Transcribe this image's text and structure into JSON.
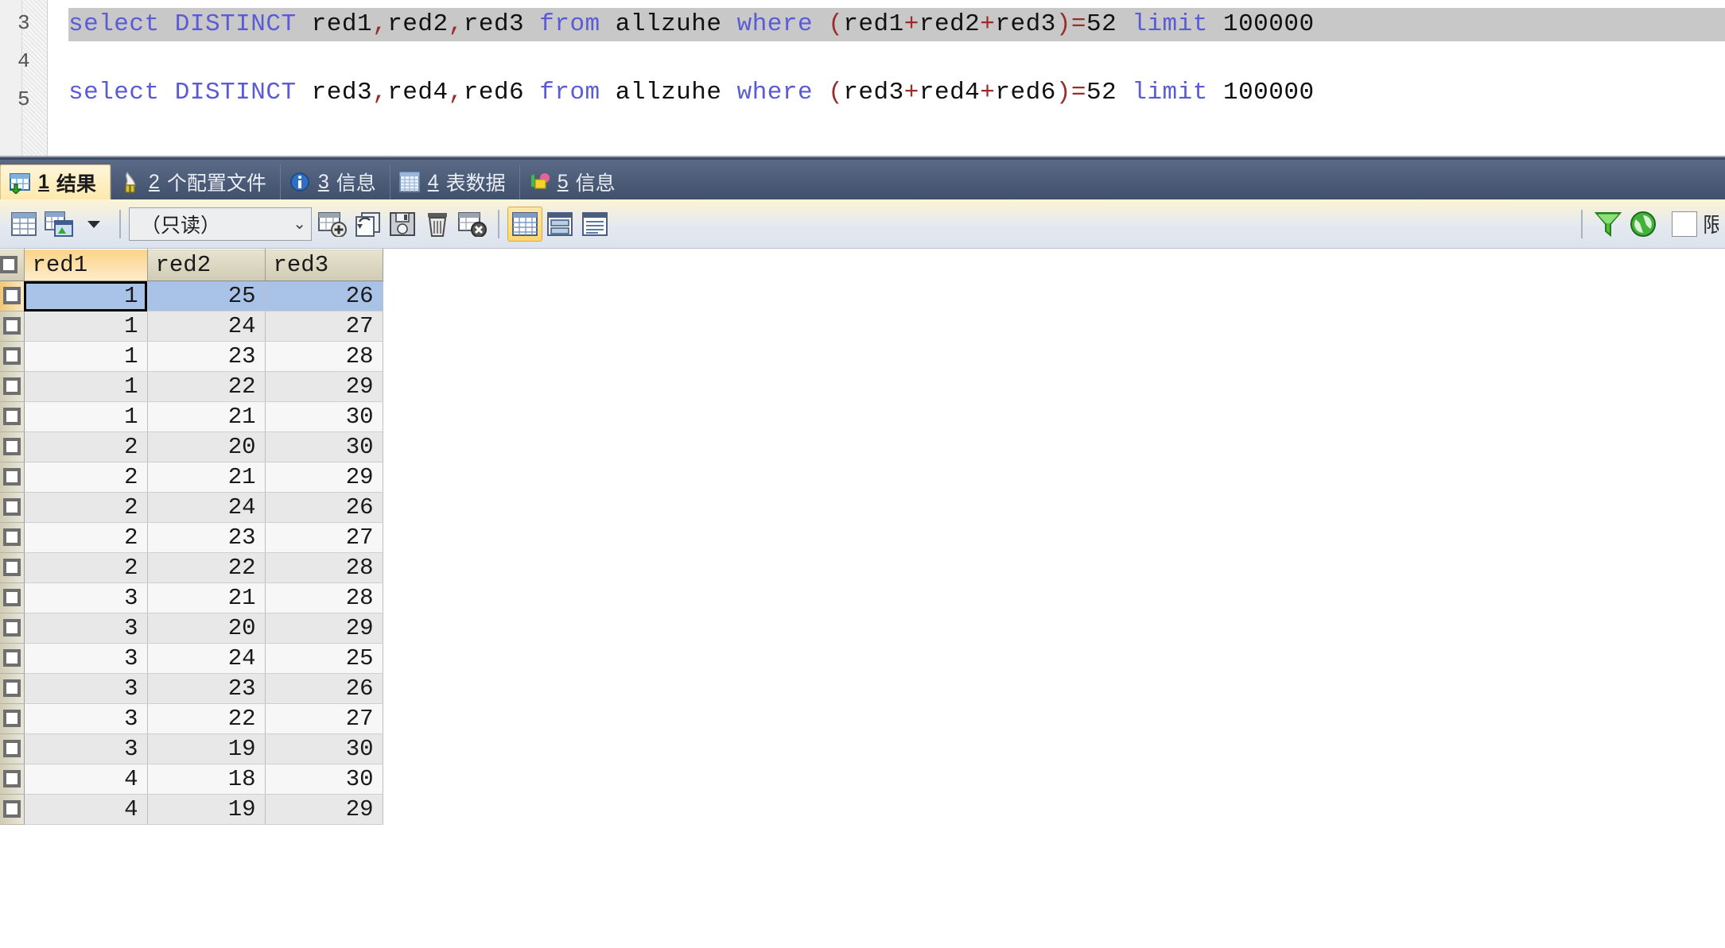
{
  "editor": {
    "line_numbers": [
      "3",
      "4",
      "5"
    ],
    "lines": [
      {
        "id": "line-1",
        "highlighted": true,
        "text": "select DISTINCT red1,red2,red3 from allzuhe where (red1+red2+red3)=52 limit 100000",
        "tokens": [
          {
            "t": "select ",
            "c": "kw"
          },
          {
            "t": "DISTINCT ",
            "c": "kw"
          },
          {
            "t": "red1",
            "c": "ident"
          },
          {
            "t": ",",
            "c": "punct"
          },
          {
            "t": "red2",
            "c": "ident"
          },
          {
            "t": ",",
            "c": "punct"
          },
          {
            "t": "red3 ",
            "c": "ident"
          },
          {
            "t": "from ",
            "c": "kw"
          },
          {
            "t": "allzuhe ",
            "c": "ident"
          },
          {
            "t": "where ",
            "c": "kw"
          },
          {
            "t": "(",
            "c": "op"
          },
          {
            "t": "red1",
            "c": "ident"
          },
          {
            "t": "+",
            "c": "op"
          },
          {
            "t": "red2",
            "c": "ident"
          },
          {
            "t": "+",
            "c": "op"
          },
          {
            "t": "red3",
            "c": "ident"
          },
          {
            "t": ")=",
            "c": "op"
          },
          {
            "t": "52 ",
            "c": "num"
          },
          {
            "t": "limit ",
            "c": "kw"
          },
          {
            "t": "100000",
            "c": "num"
          }
        ]
      },
      {
        "id": "line-2",
        "highlighted": false,
        "text": "select DISTINCT red3,red4,red6 from allzuhe where (red3+red4+red6)=52 limit 100000",
        "tokens": [
          {
            "t": "select ",
            "c": "kw"
          },
          {
            "t": "DISTINCT ",
            "c": "kw"
          },
          {
            "t": "red3",
            "c": "ident"
          },
          {
            "t": ",",
            "c": "punct"
          },
          {
            "t": "red4",
            "c": "ident"
          },
          {
            "t": ",",
            "c": "punct"
          },
          {
            "t": "red6 ",
            "c": "ident"
          },
          {
            "t": "from ",
            "c": "kw"
          },
          {
            "t": "allzuhe ",
            "c": "ident"
          },
          {
            "t": "where ",
            "c": "kw"
          },
          {
            "t": "(",
            "c": "op"
          },
          {
            "t": "red3",
            "c": "ident"
          },
          {
            "t": "+",
            "c": "op"
          },
          {
            "t": "red4",
            "c": "ident"
          },
          {
            "t": "+",
            "c": "op"
          },
          {
            "t": "red6",
            "c": "ident"
          },
          {
            "t": ")=",
            "c": "op"
          },
          {
            "t": "52 ",
            "c": "num"
          },
          {
            "t": "limit ",
            "c": "kw"
          },
          {
            "t": "100000",
            "c": "num"
          }
        ]
      }
    ]
  },
  "tabs": [
    {
      "num": "1",
      "label": "结果",
      "icon": "result-grid-icon",
      "active": true
    },
    {
      "num": "2",
      "label": "个配置文件",
      "icon": "profile-icon",
      "active": false
    },
    {
      "num": "3",
      "label": "信息",
      "icon": "info-icon",
      "active": false
    },
    {
      "num": "4",
      "label": "表数据",
      "icon": "table-data-icon",
      "active": false
    },
    {
      "num": "5",
      "label": "信息",
      "icon": "status-icon",
      "active": false
    }
  ],
  "toolbar": {
    "mode_value": "（只读）",
    "buttons": [
      {
        "name": "grid-view-icon",
        "title": "grid"
      },
      {
        "name": "export-grid-icon",
        "title": "export"
      },
      {
        "name": "dropdown-arrow-icon",
        "title": "more"
      },
      {
        "name": "add-record-icon",
        "title": "add"
      },
      {
        "name": "duplicate-record-icon",
        "title": "duplicate"
      },
      {
        "name": "save-record-icon",
        "title": "save"
      },
      {
        "name": "delete-record-icon",
        "title": "delete"
      },
      {
        "name": "cancel-record-icon",
        "title": "cancel"
      },
      {
        "name": "view-grid-icon",
        "title": "grid-view"
      },
      {
        "name": "view-form-icon",
        "title": "form-view"
      },
      {
        "name": "view-text-icon",
        "title": "text-view"
      },
      {
        "name": "filter-icon",
        "title": "filter"
      },
      {
        "name": "refresh-icon",
        "title": "refresh"
      }
    ],
    "checkbox_label": "限"
  },
  "grid": {
    "columns": [
      "red1",
      "red2",
      "red3"
    ],
    "selected_column": "red1",
    "selected_row_index": 0,
    "rows": [
      [
        "1",
        "25",
        "26"
      ],
      [
        "1",
        "24",
        "27"
      ],
      [
        "1",
        "23",
        "28"
      ],
      [
        "1",
        "22",
        "29"
      ],
      [
        "1",
        "21",
        "30"
      ],
      [
        "2",
        "20",
        "30"
      ],
      [
        "2",
        "21",
        "29"
      ],
      [
        "2",
        "24",
        "26"
      ],
      [
        "2",
        "23",
        "27"
      ],
      [
        "2",
        "22",
        "28"
      ],
      [
        "3",
        "21",
        "28"
      ],
      [
        "3",
        "20",
        "29"
      ],
      [
        "3",
        "24",
        "25"
      ],
      [
        "3",
        "23",
        "26"
      ],
      [
        "3",
        "22",
        "27"
      ],
      [
        "3",
        "19",
        "30"
      ],
      [
        "4",
        "18",
        "30"
      ],
      [
        "4",
        "19",
        "29"
      ]
    ]
  }
}
